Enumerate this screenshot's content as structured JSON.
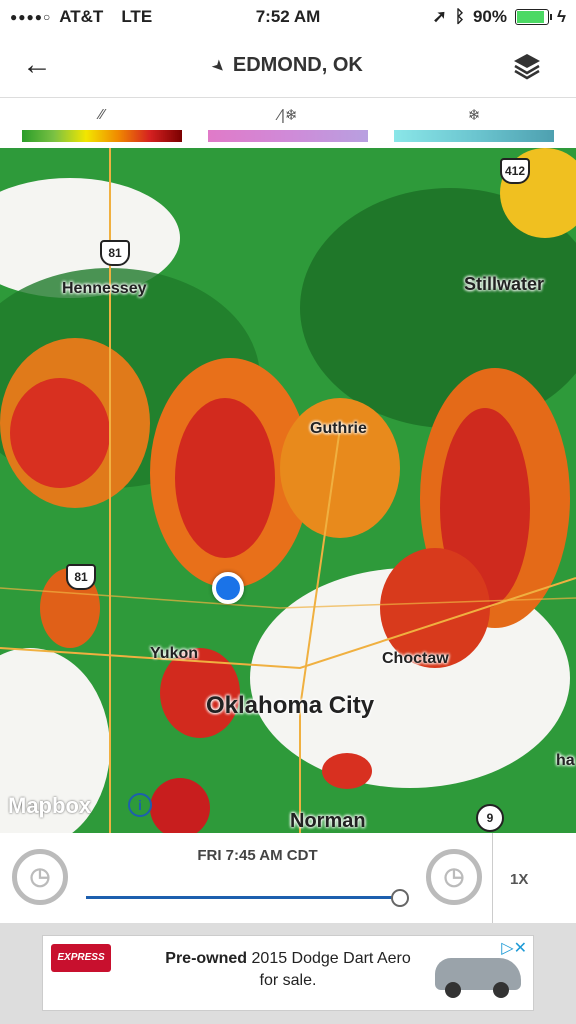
{
  "status_bar": {
    "carrier": "AT&T",
    "network": "LTE",
    "time": "7:52 AM",
    "battery": "90%",
    "battery_level": 0.9
  },
  "header": {
    "title": "EDMOND, OK",
    "back_icon": "arrow-left-icon",
    "layers_icon": "layers-icon"
  },
  "legend": [
    {
      "icon": "rain-icon",
      "glyph": "⁄⁄",
      "gradient": [
        "#2a9d2a",
        "#7ac143",
        "#f2e600",
        "#f08a00",
        "#d52020",
        "#7a0000"
      ]
    },
    {
      "icon": "mix-icon",
      "glyph": "⁄|❄",
      "gradient": [
        "#e07ac8",
        "#d08ad8",
        "#b8a0e0"
      ]
    },
    {
      "icon": "snow-icon",
      "glyph": "❄",
      "gradient": [
        "#8ae6e8",
        "#6cc6d0",
        "#4ea0b0"
      ]
    }
  ],
  "map": {
    "cities": [
      "Hennessey",
      "Stillwater",
      "Guthrie",
      "Yukon",
      "Choctaw",
      "Oklahoma City",
      "Norman"
    ],
    "highways": [
      "412",
      "81",
      "81",
      "9"
    ],
    "attribution": "Mapbox",
    "zoom_button": "±",
    "edge_label": "ha"
  },
  "playback": {
    "timestamp": "FRI 7:45 AM CDT",
    "speed": "1X",
    "progress": 0.98
  },
  "ad": {
    "bold": "Pre-owned",
    "rest": "2015 Dodge Dart Aero",
    "line2": "for sale.",
    "logo": "EXPRESS"
  }
}
